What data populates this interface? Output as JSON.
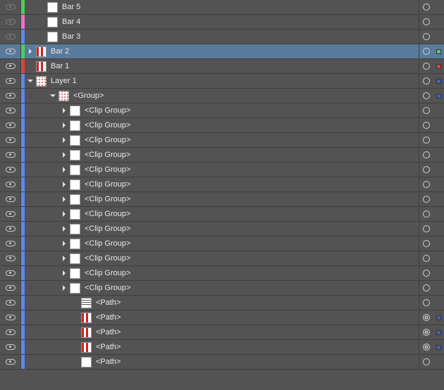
{
  "colors": {
    "green": "#4ccf5a",
    "pink": "#f070c8",
    "blue": "#5a8af0",
    "red": "#e24040",
    "orange": "#f09a32",
    "darkblue": "#3d5ec9"
  },
  "rows": [
    {
      "eye": "dim",
      "strip": "green",
      "indent": 1,
      "arrow": "",
      "thumb": "white",
      "label": "Bar 5",
      "ring": "o",
      "swatch": ""
    },
    {
      "eye": "dim",
      "strip": "pink",
      "indent": 1,
      "arrow": "",
      "thumb": "white",
      "label": "Bar 4",
      "ring": "o",
      "swatch": ""
    },
    {
      "eye": "dim",
      "strip": "blue",
      "indent": 1,
      "arrow": "",
      "thumb": "white",
      "label": "Bar 3",
      "ring": "o",
      "swatch": ""
    },
    {
      "eye": "on",
      "strip": "green",
      "indent": 0,
      "arrow": "right",
      "thumb": "stripes-v",
      "label": "Bar 2",
      "ring": "o",
      "swatch": "green",
      "selected": true
    },
    {
      "eye": "on",
      "strip": "red",
      "indent": 0,
      "arrow": "",
      "thumb": "stripes-v",
      "label": "Bar 1",
      "ring": "o",
      "swatch": "red"
    },
    {
      "eye": "on",
      "strip": "blue",
      "indent": 0,
      "arrow": "down",
      "thumb": "dots",
      "label": "Layer 1",
      "ring": "o",
      "swatch": "darkblue"
    },
    {
      "eye": "on",
      "strip": "blue",
      "indent": 2,
      "arrow": "down",
      "thumb": "dots",
      "label": "<Group>",
      "ring": "o",
      "swatch": "darkblue"
    },
    {
      "eye": "on",
      "strip": "blue",
      "indent": 3,
      "arrow": "right",
      "thumb": "white",
      "label": "<Clip Group>",
      "ring": "o",
      "swatch": ""
    },
    {
      "eye": "on",
      "strip": "blue",
      "indent": 3,
      "arrow": "right",
      "thumb": "white",
      "label": "<Clip Group>",
      "ring": "o",
      "swatch": ""
    },
    {
      "eye": "on",
      "strip": "blue",
      "indent": 3,
      "arrow": "right",
      "thumb": "white",
      "label": "<Clip Group>",
      "ring": "o",
      "swatch": ""
    },
    {
      "eye": "on",
      "strip": "blue",
      "indent": 3,
      "arrow": "right",
      "thumb": "white",
      "label": "<Clip Group>",
      "ring": "o",
      "swatch": ""
    },
    {
      "eye": "on",
      "strip": "blue",
      "indent": 3,
      "arrow": "right",
      "thumb": "white",
      "label": "<Clip Group>",
      "ring": "o",
      "swatch": ""
    },
    {
      "eye": "on",
      "strip": "blue",
      "indent": 3,
      "arrow": "right",
      "thumb": "white",
      "label": "<Clip Group>",
      "ring": "o",
      "swatch": ""
    },
    {
      "eye": "on",
      "strip": "blue",
      "indent": 3,
      "arrow": "right",
      "thumb": "white",
      "label": "<Clip Group>",
      "ring": "o",
      "swatch": ""
    },
    {
      "eye": "on",
      "strip": "blue",
      "indent": 3,
      "arrow": "right",
      "thumb": "white",
      "label": "<Clip Group>",
      "ring": "o",
      "swatch": ""
    },
    {
      "eye": "on",
      "strip": "blue",
      "indent": 3,
      "arrow": "right",
      "thumb": "white",
      "label": "<Clip Group>",
      "ring": "o",
      "swatch": ""
    },
    {
      "eye": "on",
      "strip": "blue",
      "indent": 3,
      "arrow": "right",
      "thumb": "white",
      "label": "<Clip Group>",
      "ring": "o",
      "swatch": ""
    },
    {
      "eye": "on",
      "strip": "blue",
      "indent": 3,
      "arrow": "right",
      "thumb": "white",
      "label": "<Clip Group>",
      "ring": "o",
      "swatch": ""
    },
    {
      "eye": "on",
      "strip": "blue",
      "indent": 3,
      "arrow": "right",
      "thumb": "white",
      "label": "<Clip Group>",
      "ring": "o",
      "swatch": ""
    },
    {
      "eye": "on",
      "strip": "blue",
      "indent": 3,
      "arrow": "right",
      "thumb": "white",
      "label": "<Clip Group>",
      "ring": "o",
      "swatch": ""
    },
    {
      "eye": "on",
      "strip": "blue",
      "indent": 4,
      "arrow": "",
      "thumb": "stripes-h",
      "label": "<Path>",
      "ring": "o",
      "swatch": ""
    },
    {
      "eye": "on",
      "strip": "blue",
      "indent": 4,
      "arrow": "",
      "thumb": "stripes-v",
      "label": "<Path>",
      "ring": "dbl",
      "swatch": "darkblue"
    },
    {
      "eye": "on",
      "strip": "blue",
      "indent": 4,
      "arrow": "",
      "thumb": "stripes-v",
      "label": "<Path>",
      "ring": "dbl",
      "swatch": "darkblue"
    },
    {
      "eye": "on",
      "strip": "blue",
      "indent": 4,
      "arrow": "",
      "thumb": "stripes-v",
      "label": "<Path>",
      "ring": "dbl",
      "swatch": "darkblue"
    },
    {
      "eye": "on",
      "strip": "blue",
      "indent": 4,
      "arrow": "",
      "thumb": "white",
      "label": "<Path>",
      "ring": "o",
      "swatch": ""
    }
  ]
}
